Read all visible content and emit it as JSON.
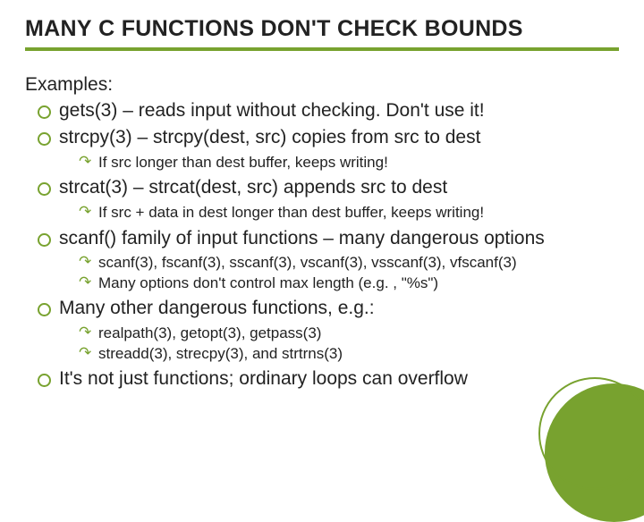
{
  "title_html": "M<span class='sc'>ANY</span> C <span class='sc'>FUNCTIONS DON'T CHECK BOUNDS</span>",
  "lead": "Examples:",
  "items": [
    {
      "text": "gets(3) – reads input without checking. Don't use it!"
    },
    {
      "text": "strcpy(3) – strcpy(dest, src) copies from src to dest",
      "sub": [
        "If src longer than dest buffer, keeps writing!"
      ]
    },
    {
      "text": "strcat(3) – strcat(dest, src) appends src to dest",
      "sub": [
        "If  src + data in dest longer than dest buffer, keeps writing!"
      ]
    },
    {
      "text": "scanf() family of input functions – many dangerous options",
      "sub": [
        "scanf(3), fscanf(3), sscanf(3), vscanf(3), vsscanf(3), vfscanf(3)",
        "Many options don't control max length (e.g. , \"%s\")"
      ]
    },
    {
      "text": "Many other dangerous functions, e.g.:",
      "sub": [
        "realpath(3), getopt(3), getpass(3)",
        "streadd(3), strecpy(3), and strtrns(3)"
      ]
    },
    {
      "text": "It's not just functions; ordinary loops can overflow"
    }
  ]
}
